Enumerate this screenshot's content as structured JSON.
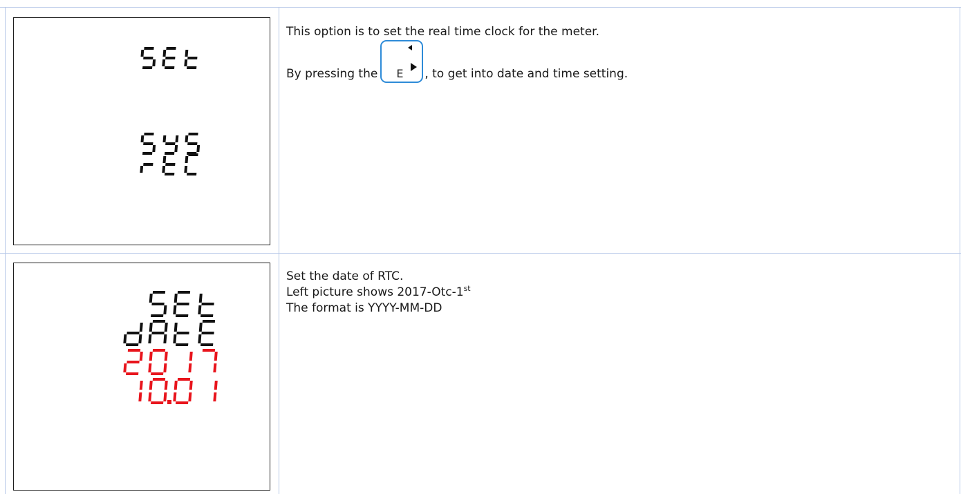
{
  "rows": [
    {
      "lcd": {
        "lines": [
          {
            "text": "SEt",
            "color": "#111111"
          },
          {
            "text": "SYS",
            "color": "#111111"
          },
          {
            "text": "rtC",
            "color": "#111111"
          }
        ]
      },
      "text": {
        "line1": "This option is to set the real time clock for the meter.",
        "line2_before": "By pressing the",
        "line2_after": ", to get into date and time setting.",
        "key_label": "E"
      }
    },
    {
      "lcd": {
        "lines": [
          {
            "text": "SEt",
            "color": "#111111"
          },
          {
            "text": "dAtE",
            "color": "#111111"
          },
          {
            "text": "2017",
            "color": "#e8141c"
          },
          {
            "text": "10.01",
            "color": "#e8141c"
          }
        ]
      },
      "text": {
        "line1": "Set the date of RTC.",
        "line2_main": "Left picture shows 2017-Otc-1",
        "line2_sup": "st",
        "line3": "The format is YYYY-MM-DD"
      }
    }
  ],
  "colors": {
    "grid": "#b4c6e7",
    "key_border": "#2e8bd8",
    "segment_black": "#111111",
    "segment_red": "#e8141c"
  },
  "icons": {
    "key": "e-enter-key-icon",
    "key_arrows": [
      "left-triangle-icon",
      "right-triangle-icon"
    ]
  }
}
